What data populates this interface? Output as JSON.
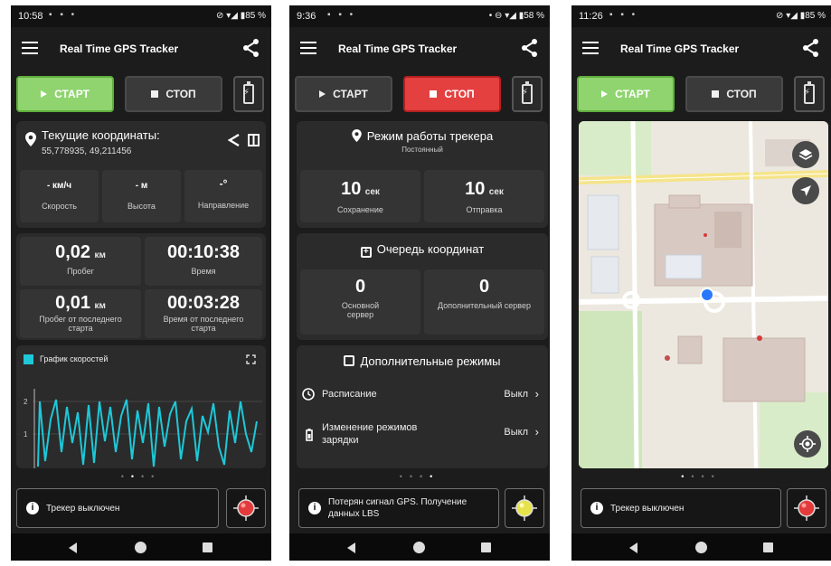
{
  "app": {
    "title": "Real Time GPS Tracker"
  },
  "buttons": {
    "start": "СТАРТ",
    "stop": "СТОП"
  },
  "colors": {
    "start_active": "#8fd46f",
    "stop_active": "#e44040",
    "speed_line": "#1ec8d8",
    "map_bg": "#ece8df"
  },
  "screen1": {
    "status": {
      "time": "10:58",
      "battery": "85 %"
    },
    "coords": {
      "title": "Текущие координаты:",
      "value": "55,778935, 49,211456"
    },
    "metrics": [
      {
        "value": "- км/ч",
        "label": "Скорость"
      },
      {
        "value": "- м",
        "label": "Высота"
      },
      {
        "value": "-°",
        "label": "Направление"
      }
    ],
    "stats": [
      {
        "value": "0,02",
        "unit": "км",
        "label": "Пробег"
      },
      {
        "value": "00:10:38",
        "unit": "",
        "label": "Время"
      },
      {
        "value": "0,01",
        "unit": "км",
        "label": "Пробег от последнего старта"
      },
      {
        "value": "00:03:28",
        "unit": "",
        "label": "Время от последнего старта"
      }
    ],
    "chart": {
      "legend": "График скоростей",
      "y_ticks": [
        "2",
        "1"
      ]
    },
    "tracker_status": "Трекер выключен"
  },
  "screen2": {
    "status": {
      "time": "9:36",
      "battery": "58 %"
    },
    "mode": {
      "title": "Режим работы трекера",
      "value": "Постоянный"
    },
    "intervals": [
      {
        "value": "10",
        "unit": "сек",
        "label": "Сохранение"
      },
      {
        "value": "10",
        "unit": "сек",
        "label": "Отправка"
      }
    ],
    "queue": {
      "title": "Очередь координат"
    },
    "queue_tiles": [
      {
        "value": "0",
        "label": "Основной сервер"
      },
      {
        "value": "0",
        "label": "Дополнительный сервер"
      }
    ],
    "extra": {
      "title": "Дополнительные режимы"
    },
    "extra_items": [
      {
        "label": "Расписание",
        "value": "Выкл"
      },
      {
        "label": "Изменение режимов зарядки",
        "value": "Выкл"
      }
    ],
    "tracker_status": "Потерян сигнал GPS. Получение данных LBS"
  },
  "screen3": {
    "status": {
      "time": "11:26",
      "battery": "85 %"
    },
    "tracker_status": "Трекер выключен"
  }
}
